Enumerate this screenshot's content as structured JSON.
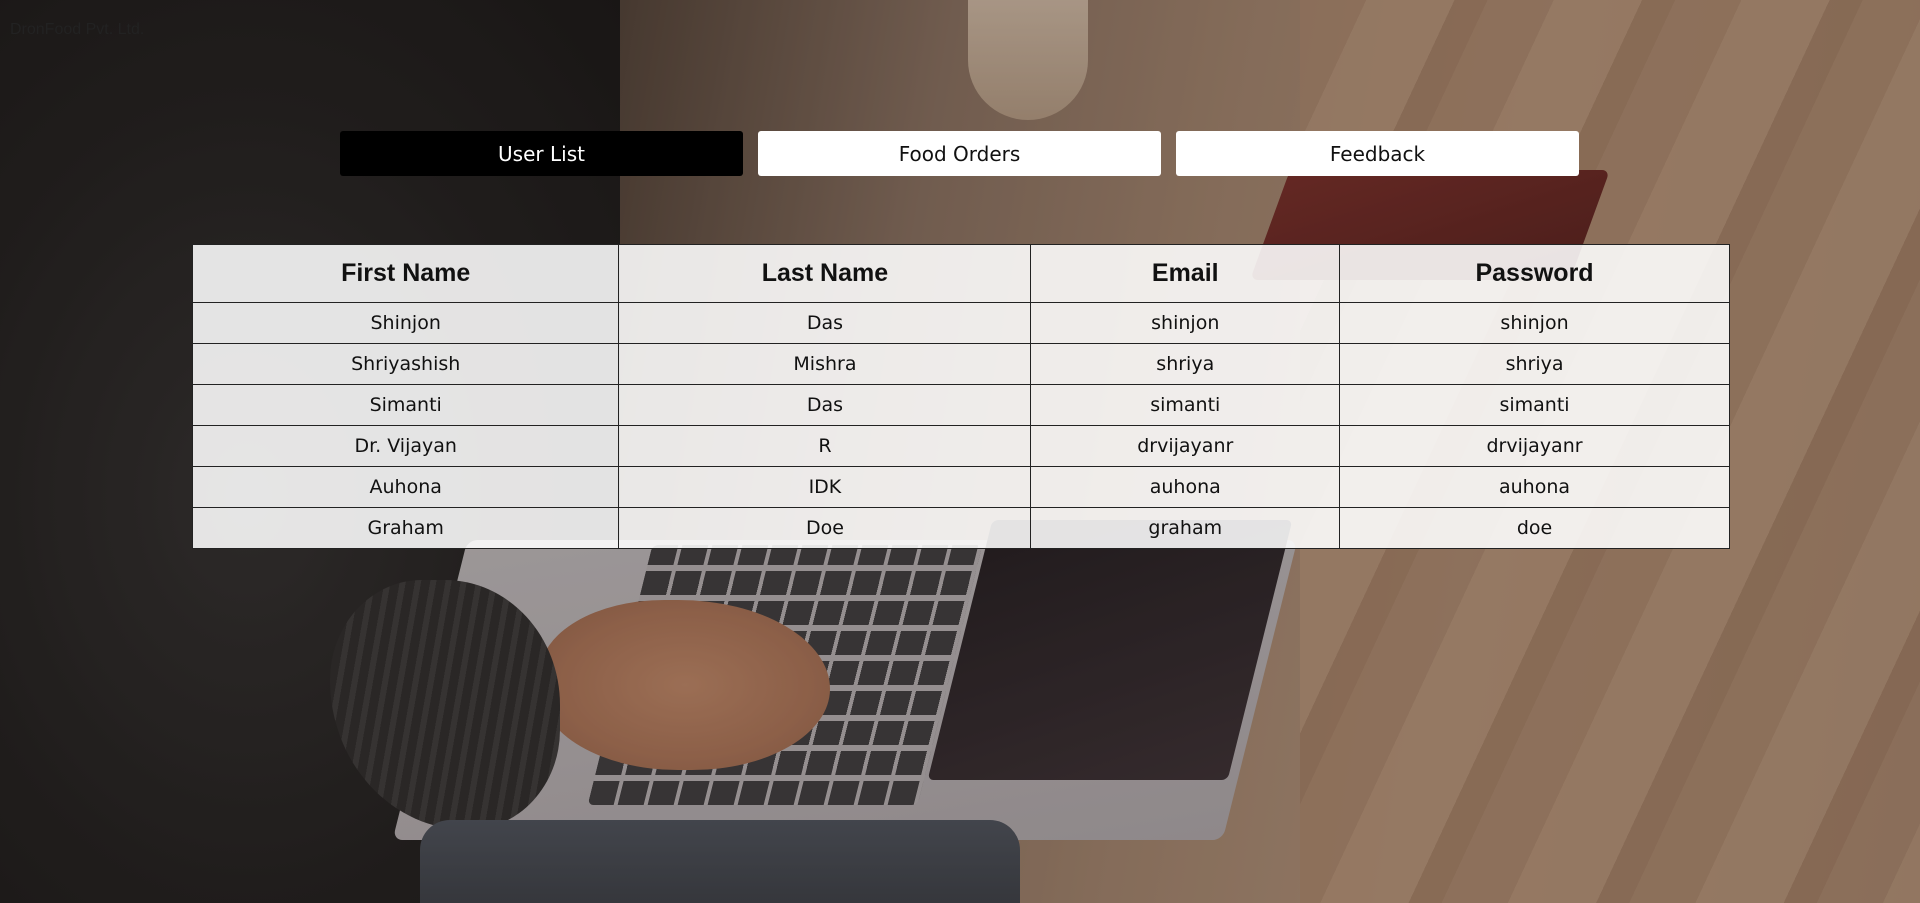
{
  "brand": {
    "name": "DronFood Pvt. Ltd."
  },
  "nav": {
    "tabs": [
      {
        "label": "User List",
        "active": true
      },
      {
        "label": "Food Orders",
        "active": false
      },
      {
        "label": "Feedback",
        "active": false
      }
    ]
  },
  "users_table": {
    "headers": [
      "First Name",
      "Last Name",
      "Email",
      "Password"
    ],
    "rows": [
      [
        "Shinjon",
        "Das",
        "shinjon",
        "shinjon"
      ],
      [
        "Shriyashish",
        "Mishra",
        "shriya",
        "shriya"
      ],
      [
        "Simanti",
        "Das",
        "simanti",
        "simanti"
      ],
      [
        "Dr. Vijayan",
        "R",
        "drvijayanr",
        "drvijayanr"
      ],
      [
        "Auhona",
        "IDK",
        "auhona",
        "auhona"
      ],
      [
        "Graham",
        "Doe",
        "graham",
        "doe"
      ]
    ]
  },
  "colors": {
    "active_tab_bg": "#000000",
    "tab_bg": "#ffffff",
    "table_bg": "rgba(255,255,255,0.88)"
  }
}
